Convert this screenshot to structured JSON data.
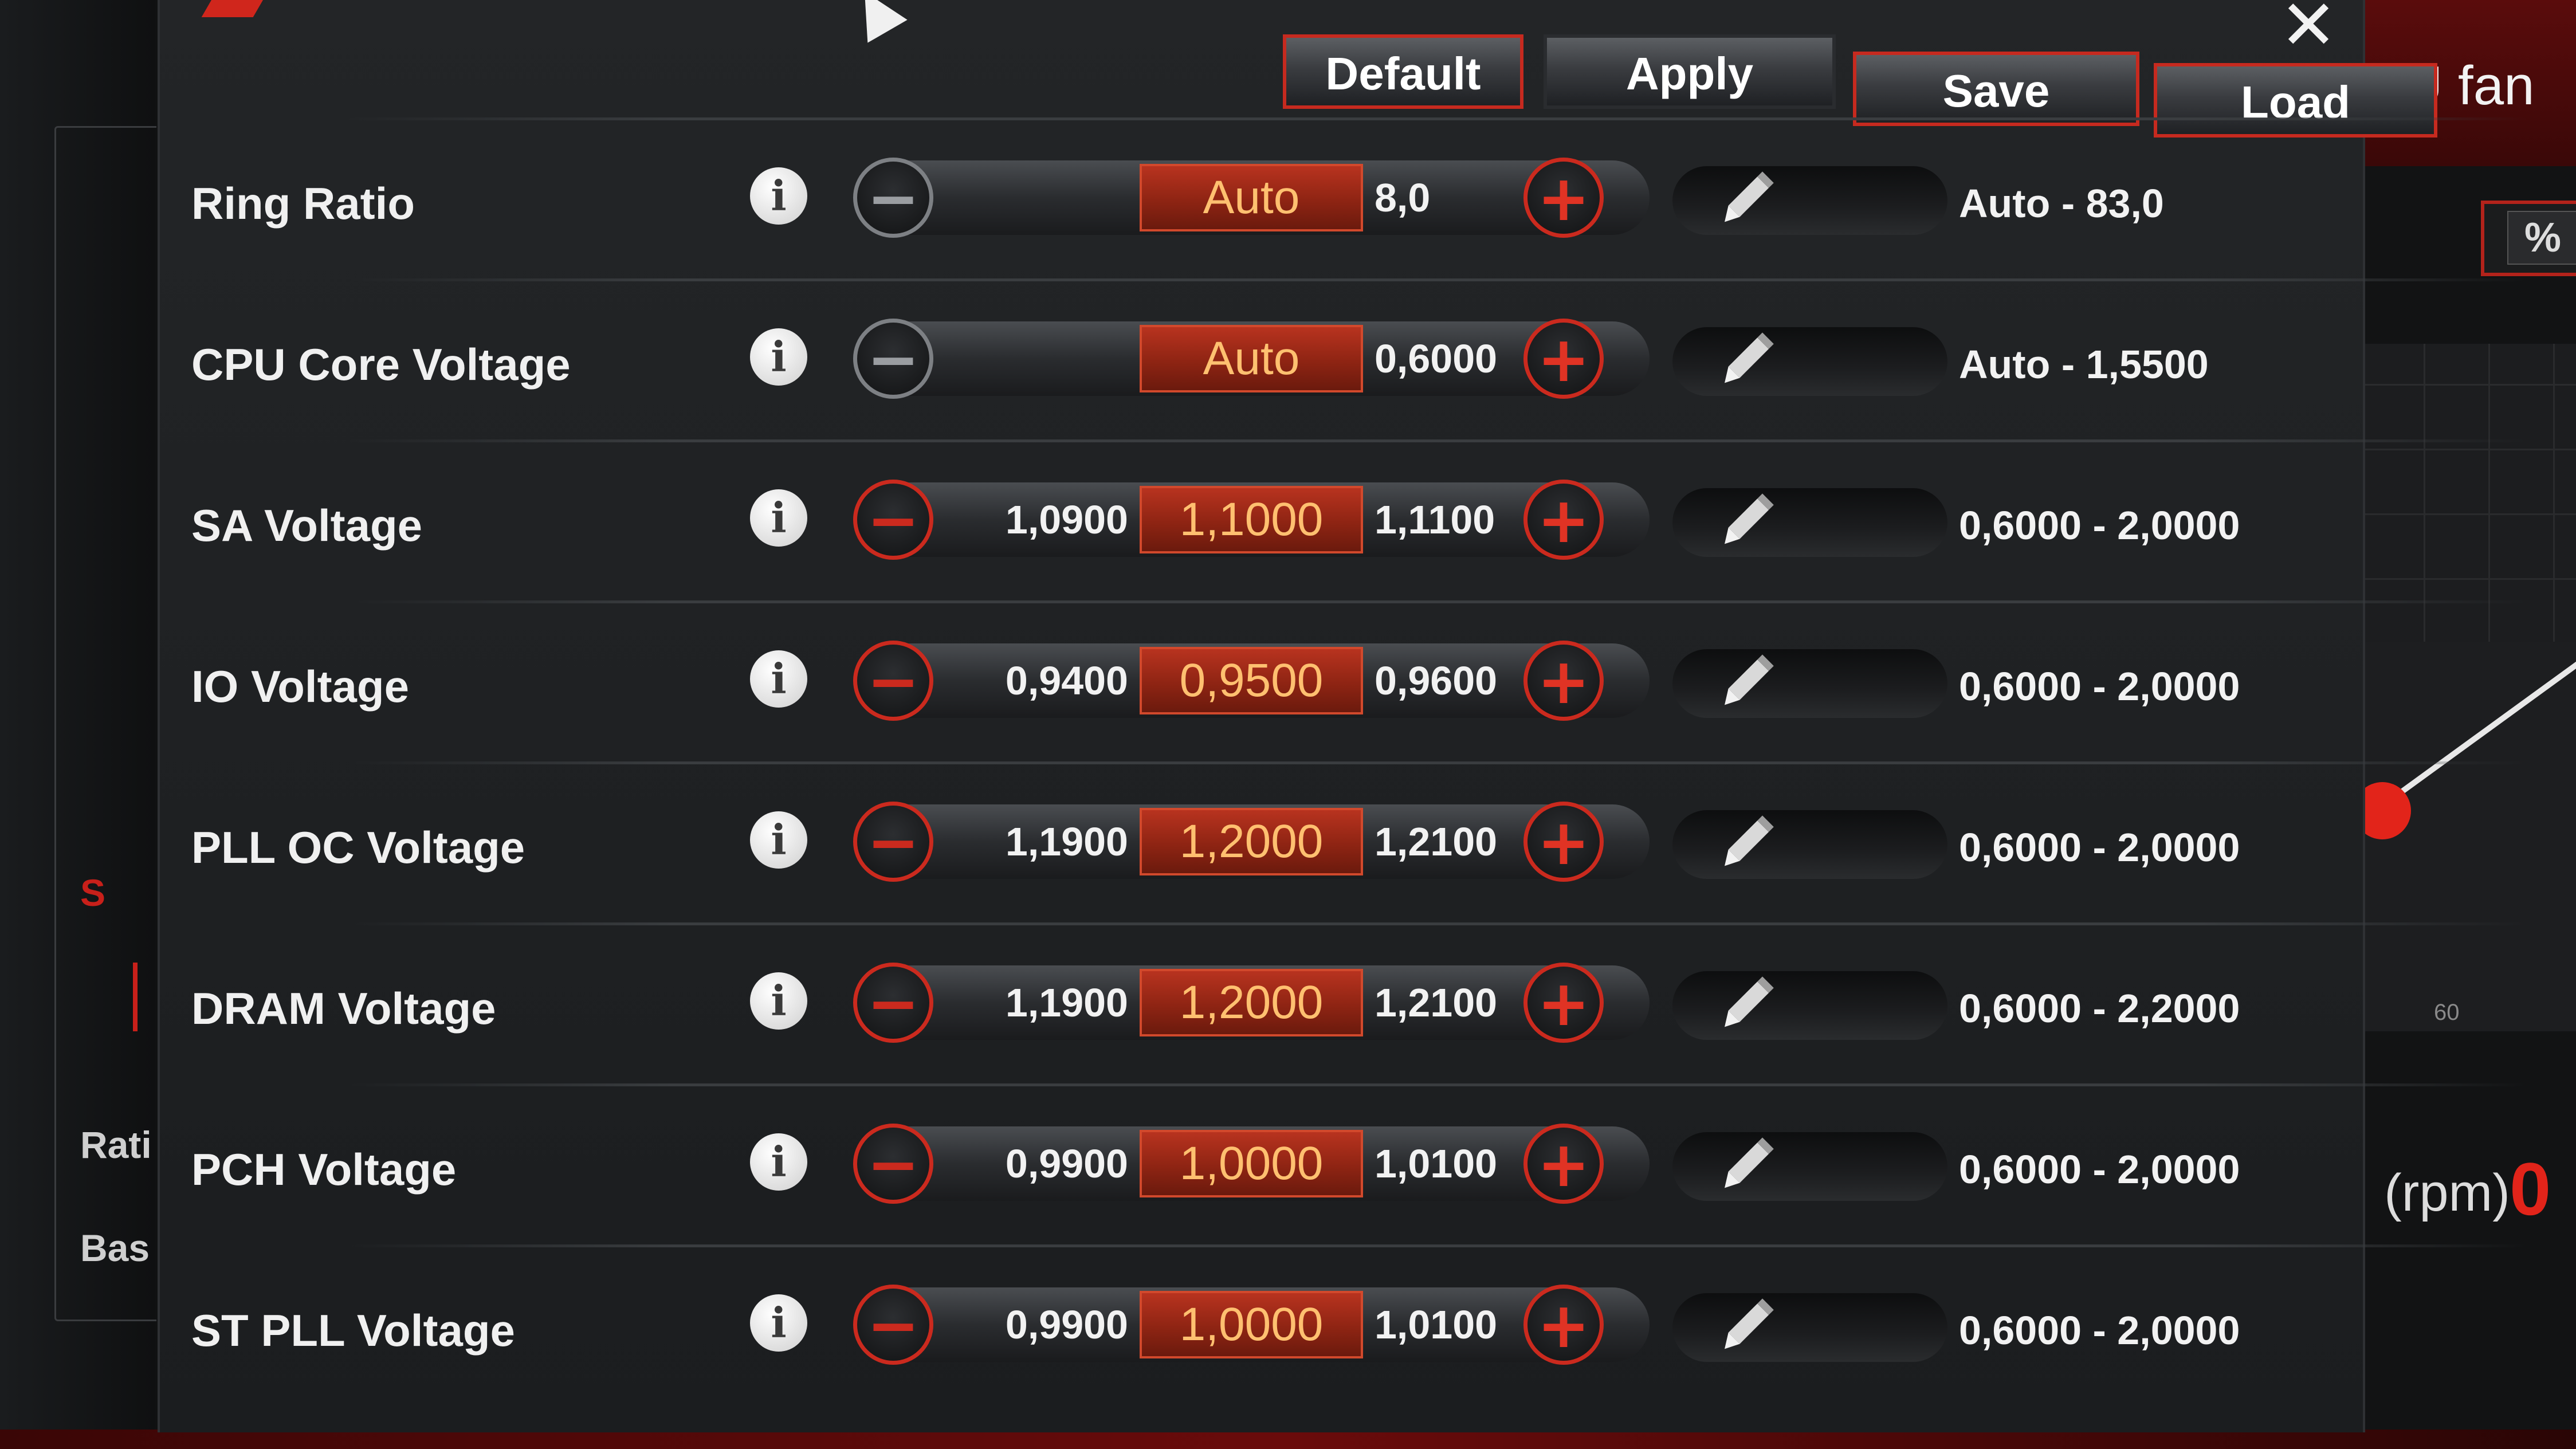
{
  "background": {
    "fan_title": "PU fan",
    "percent_label": "%",
    "left_labels": [
      "S",
      "Rati",
      "Bas"
    ],
    "fan_axis_tick": "60",
    "rpm_label": ". (rpm)",
    "rpm_value": "0"
  },
  "dialog": {
    "close_symbol": "✕",
    "toolbar": {
      "default_label": "Default",
      "apply_label": "Apply",
      "save_label": "Save",
      "load_label": "Load"
    },
    "info_symbol": "i",
    "minus_symbol": "−",
    "plus_symbol": "+",
    "rows": [
      {
        "label": "Ring Ratio",
        "prev": "",
        "current": "Auto",
        "next": "8,0",
        "range": "Auto - 83,0",
        "minus_enabled": false
      },
      {
        "label": "CPU Core Voltage",
        "prev": "",
        "current": "Auto",
        "next": "0,6000",
        "range": "Auto - 1,5500",
        "minus_enabled": false
      },
      {
        "label": "SA Voltage",
        "prev": "1,0900",
        "current": "1,1000",
        "next": "1,1100",
        "range": "0,6000 - 2,0000",
        "minus_enabled": true
      },
      {
        "label": "IO Voltage",
        "prev": "0,9400",
        "current": "0,9500",
        "next": "0,9600",
        "range": "0,6000 - 2,0000",
        "minus_enabled": true
      },
      {
        "label": "PLL OC Voltage",
        "prev": "1,1900",
        "current": "1,2000",
        "next": "1,2100",
        "range": "0,6000 - 2,0000",
        "minus_enabled": true
      },
      {
        "label": "DRAM Voltage",
        "prev": "1,1900",
        "current": "1,2000",
        "next": "1,2100",
        "range": "0,6000 - 2,2000",
        "minus_enabled": true
      },
      {
        "label": "PCH Voltage",
        "prev": "0,9900",
        "current": "1,0000",
        "next": "1,0100",
        "range": "0,6000 - 2,0000",
        "minus_enabled": true
      },
      {
        "label": "ST PLL Voltage",
        "prev": "0,9900",
        "current": "1,0000",
        "next": "1,0100",
        "range": "0,6000 - 2,0000",
        "minus_enabled": true
      }
    ]
  },
  "colors": {
    "accent_red": "#cb2a1e",
    "current_value_text": "#ffc070",
    "background": "#1b1d1f"
  },
  "icons": [
    "info-icon",
    "minus-icon",
    "plus-icon",
    "pencil-icon",
    "close-icon",
    "cursor-icon"
  ]
}
